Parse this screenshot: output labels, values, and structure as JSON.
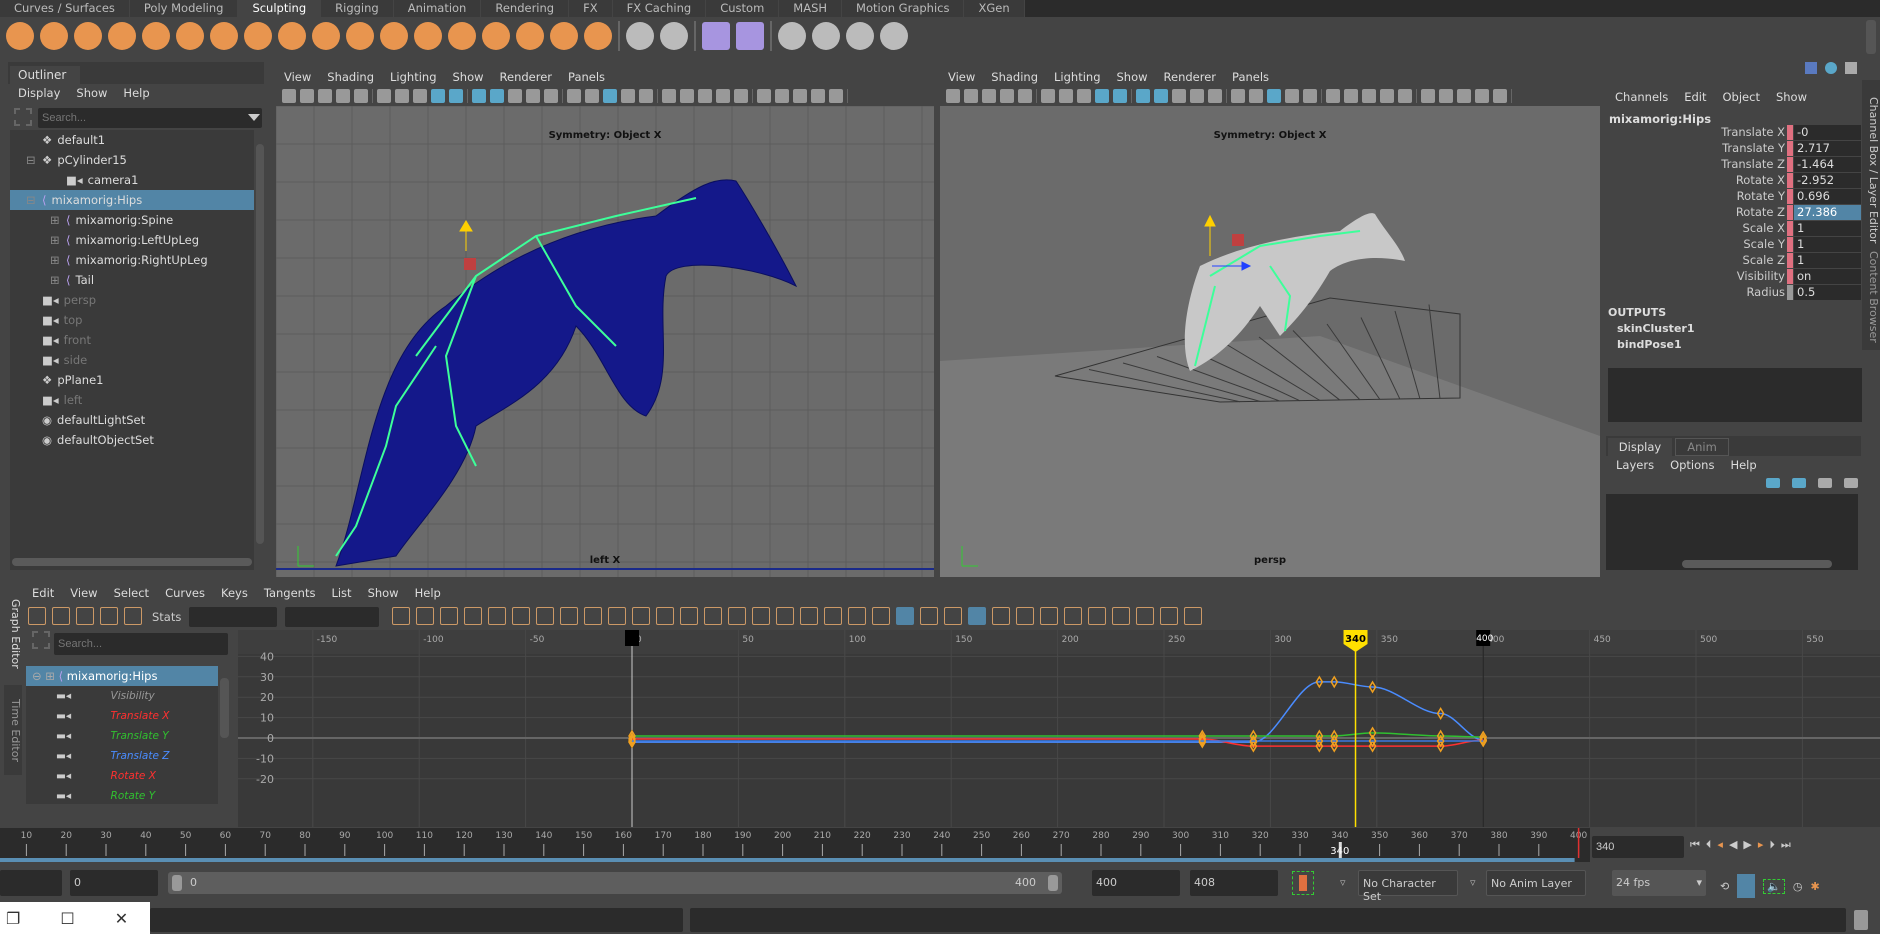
{
  "shelf_tabs": [
    "Curves / Surfaces",
    "Poly Modeling",
    "Sculpting",
    "Rigging",
    "Animation",
    "Rendering",
    "FX",
    "FX Caching",
    "Custom",
    "MASH",
    "Motion Graphics",
    "XGen"
  ],
  "active_shelf_tab": "Sculpting",
  "shelf_icons": [
    "sculpt",
    "smooth",
    "relax",
    "grab",
    "pinch",
    "flatten",
    "foamy",
    "spray",
    "repeat",
    "imprint",
    "wax",
    "scrape",
    "fill",
    "knife",
    "smear",
    "bulge",
    "amplify",
    "freeze",
    "sep",
    "convert-to-frozen",
    "mesh-display",
    "sep",
    "sculpt-geometry",
    "sculpt-character",
    "sep",
    "mash-1",
    "mash-2",
    "mash-3",
    "mash-4"
  ],
  "outliner": {
    "tab": "Outliner",
    "menu": [
      "Display",
      "Show",
      "Help"
    ],
    "search_placeholder": "Search...",
    "items": [
      {
        "label": "default1",
        "icon": "transform-icon",
        "indent": 1,
        "dim": false
      },
      {
        "label": "pCylinder15",
        "icon": "transform-icon",
        "indent": 1,
        "dim": false,
        "expander": "minus"
      },
      {
        "label": "camera1",
        "icon": "camera-icon",
        "indent": 2,
        "dim": false
      },
      {
        "label": "mixamorig:Hips",
        "icon": "joint-icon",
        "indent": 1,
        "dim": false,
        "selected": true,
        "expander": "minus"
      },
      {
        "label": "mixamorig:Spine",
        "icon": "joint-icon",
        "indent": 2,
        "dim": false,
        "expander": "plus"
      },
      {
        "label": "mixamorig:LeftUpLeg",
        "icon": "joint-icon",
        "indent": 2,
        "dim": false,
        "expander": "plus"
      },
      {
        "label": "mixamorig:RightUpLeg",
        "icon": "joint-icon",
        "indent": 2,
        "dim": false,
        "expander": "plus"
      },
      {
        "label": "Tail",
        "icon": "joint-icon",
        "indent": 2,
        "dim": false,
        "expander": "plus"
      },
      {
        "label": "persp",
        "icon": "camera-icon",
        "indent": 1,
        "dim": true
      },
      {
        "label": "top",
        "icon": "camera-icon",
        "indent": 1,
        "dim": true
      },
      {
        "label": "front",
        "icon": "camera-icon",
        "indent": 1,
        "dim": true
      },
      {
        "label": "side",
        "icon": "camera-icon",
        "indent": 1,
        "dim": true
      },
      {
        "label": "pPlane1",
        "icon": "transform-icon",
        "indent": 1,
        "dim": false
      },
      {
        "label": "left",
        "icon": "camera-icon",
        "indent": 1,
        "dim": true
      },
      {
        "label": "defaultLightSet",
        "icon": "set-icon",
        "indent": 1,
        "dim": false
      },
      {
        "label": "defaultObjectSet",
        "icon": "set-icon",
        "indent": 1,
        "dim": false
      }
    ]
  },
  "viewport_left": {
    "menu": [
      "View",
      "Shading",
      "Lighting",
      "Show",
      "Renderer",
      "Panels"
    ],
    "hud": "Symmetry: Object X",
    "camera": "left X"
  },
  "viewport_right": {
    "menu": [
      "View",
      "Shading",
      "Lighting",
      "Show",
      "Renderer",
      "Panels"
    ],
    "hud": "Symmetry: Object X",
    "camera": "persp"
  },
  "channel_box": {
    "menu": [
      "Channels",
      "Edit",
      "Object",
      "Show"
    ],
    "node": "mixamorig:Hips",
    "channels": [
      {
        "label": "Translate X",
        "value": "-0"
      },
      {
        "label": "Translate Y",
        "value": "2.717"
      },
      {
        "label": "Translate Z",
        "value": "-1.464"
      },
      {
        "label": "Rotate X",
        "value": "-2.952"
      },
      {
        "label": "Rotate Y",
        "value": "0.696"
      },
      {
        "label": "Rotate Z",
        "value": "27.386",
        "selected": true
      },
      {
        "label": "Scale X",
        "value": "1"
      },
      {
        "label": "Scale Y",
        "value": "1"
      },
      {
        "label": "Scale Z",
        "value": "1"
      },
      {
        "label": "Visibility",
        "value": "on"
      },
      {
        "label": "Radius",
        "value": "0.5",
        "grey": true
      }
    ],
    "outputs_title": "OUTPUTS",
    "outputs": [
      "skinCluster1",
      "bindPose1"
    ],
    "side_tabs": [
      "Channel Box / Layer Editor",
      "Content Browser"
    ]
  },
  "layer_editor": {
    "tabs": [
      "Display",
      "Anim"
    ],
    "active": "Display",
    "menu": [
      "Layers",
      "Options",
      "Help"
    ]
  },
  "graph_editor": {
    "side_tabs": [
      "Graph Editor",
      "Time Editor"
    ],
    "menu": [
      "Edit",
      "View",
      "Select",
      "Curves",
      "Keys",
      "Tangents",
      "List",
      "Show",
      "Help"
    ],
    "stats_label": "Stats",
    "search_placeholder": "Search...",
    "node": "mixamorig:Hips",
    "channels": [
      {
        "label": "Visibility",
        "color": "#999999"
      },
      {
        "label": "Translate X",
        "color": "#ff3030"
      },
      {
        "label": "Translate Y",
        "color": "#30c030"
      },
      {
        "label": "Translate Z",
        "color": "#4a8cff"
      },
      {
        "label": "Rotate X",
        "color": "#ff3030"
      },
      {
        "label": "Rotate Y",
        "color": "#30c030"
      }
    ],
    "frame_labels": [
      -150,
      -100,
      -50,
      0,
      50,
      100,
      150,
      200,
      250,
      300,
      340,
      350,
      400,
      450,
      500,
      550
    ],
    "value_labels": [
      40,
      30,
      20,
      10,
      0,
      -10,
      -20
    ],
    "current_frame": 340,
    "range_end": 400,
    "curves": [
      {
        "color": "#4a8cff",
        "keys": [
          [
            0,
            -2
          ],
          [
            268,
            -2
          ],
          [
            292,
            -2
          ],
          [
            323,
            27.5
          ],
          [
            330,
            27.5
          ],
          [
            348,
            25
          ],
          [
            380,
            12
          ],
          [
            400,
            -1
          ]
        ]
      },
      {
        "color": "#30c030",
        "keys": [
          [
            0,
            1
          ],
          [
            268,
            1
          ],
          [
            292,
            1
          ],
          [
            323,
            1
          ],
          [
            330,
            1
          ],
          [
            348,
            2.5
          ],
          [
            380,
            1
          ],
          [
            400,
            0.5
          ]
        ]
      },
      {
        "color": "#ff3030",
        "keys": [
          [
            0,
            -0.5
          ],
          [
            268,
            -0.5
          ],
          [
            292,
            -4
          ],
          [
            323,
            -4
          ],
          [
            330,
            -4
          ],
          [
            348,
            -4
          ],
          [
            380,
            -4
          ],
          [
            400,
            -1
          ]
        ]
      },
      {
        "color": "#3a78e0",
        "keys": [
          [
            0,
            -1.5
          ],
          [
            268,
            -1.5
          ],
          [
            292,
            -1.5
          ],
          [
            323,
            -1.5
          ],
          [
            330,
            -1.5
          ],
          [
            348,
            -1.5
          ],
          [
            380,
            -1.5
          ],
          [
            400,
            -1.5
          ]
        ]
      }
    ]
  },
  "time_slider": {
    "start": 1,
    "end": 400,
    "current": 340,
    "current_field": "340",
    "tick_step": 10
  },
  "range_slider": {
    "start_field": "",
    "min_field": "0",
    "range_start": "0",
    "range_end": "400",
    "end_field": "400",
    "max_field": "408",
    "character_set": "No Character Set",
    "anim_layer": "No Anim Layer",
    "fps": "24 fps"
  },
  "colors": {
    "accent": "#5285a6",
    "key": "#f0a020",
    "timeline_bar": "#5a8fb4"
  }
}
